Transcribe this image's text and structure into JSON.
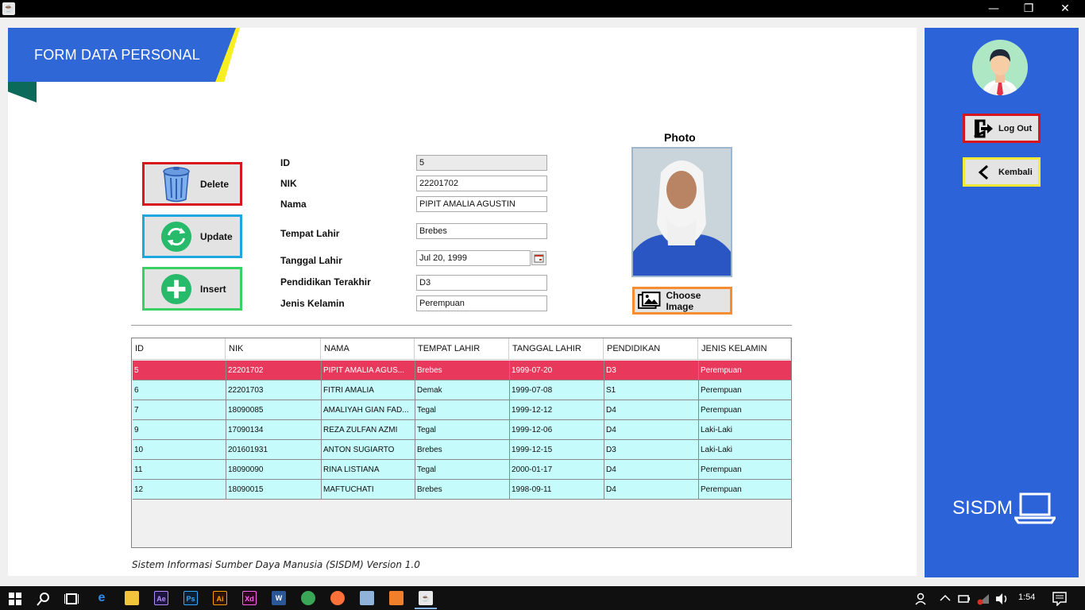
{
  "window": {
    "minimize_glyph": "—",
    "restore_glyph": "❐",
    "close_glyph": "✕"
  },
  "header": {
    "title": "FORM DATA PERSONAL"
  },
  "actions": {
    "delete_label": "Delete",
    "update_label": "Update",
    "insert_label": "Insert"
  },
  "form": {
    "id_label": "ID",
    "id_value": "5",
    "nik_label": "NIK",
    "nik_value": "22201702",
    "nama_label": "Nama",
    "nama_value": "PIPIT AMALIA AGUSTIN",
    "tempat_label": "Tempat Lahir",
    "tempat_value": "Brebes",
    "tanggal_label": "Tanggal Lahir",
    "tanggal_value": "Jul 20, 1999",
    "pendidikan_label": "Pendidikan Terakhir",
    "pendidikan_value": "D3",
    "jk_label": "Jenis Kelamin",
    "jk_value": "Perempuan"
  },
  "photo": {
    "label": "Photo",
    "choose_label": "Choose Image"
  },
  "table": {
    "columns": [
      "ID",
      "NIK",
      "NAMA",
      "TEMPAT LAHIR",
      "TANGGAL LAHIR",
      "PENDIDIKAN",
      "JENIS KELAMIN"
    ],
    "rows": [
      [
        "5",
        "22201702",
        "PIPIT AMALIA AGUS...",
        "Brebes",
        "1999-07-20",
        "D3",
        "Perempuan"
      ],
      [
        "6",
        "22201703",
        "FITRI AMALIA",
        "Demak",
        "1999-07-08",
        "S1",
        "Perempuan"
      ],
      [
        "7",
        "18090085",
        "AMALIYAH GIAN FAD...",
        "Tegal",
        "1999-12-12",
        "D4",
        "Perempuan"
      ],
      [
        "9",
        "17090134",
        "REZA ZULFAN AZMI",
        "Tegal",
        "1999-12-06",
        "D4",
        "Laki-Laki"
      ],
      [
        "10",
        "201601931",
        "ANTON SUGIARTO",
        "Brebes",
        "1999-12-15",
        "D3",
        "Laki-Laki"
      ],
      [
        "11",
        "18090090",
        "RINA LISTIANA",
        "Tegal",
        "2000-01-17",
        "D4",
        "Perempuan"
      ],
      [
        "12",
        "18090015",
        "MAFTUCHATI",
        "Brebes",
        "1998-09-11",
        "D4",
        "Perempuan"
      ]
    ]
  },
  "footer": {
    "text": "Sistem Informasi Sumber Daya Manusia (SISDM) Version 1.0"
  },
  "side": {
    "logout_label": "Log Out",
    "kembali_label": "Kembali",
    "logo_text": "SISDM"
  },
  "taskbar": {
    "clock": "1:54"
  },
  "colors": {
    "accent_blue": "#2d63d9",
    "selected_row": "#e8395c",
    "row_bg": "#c5fbfb"
  }
}
